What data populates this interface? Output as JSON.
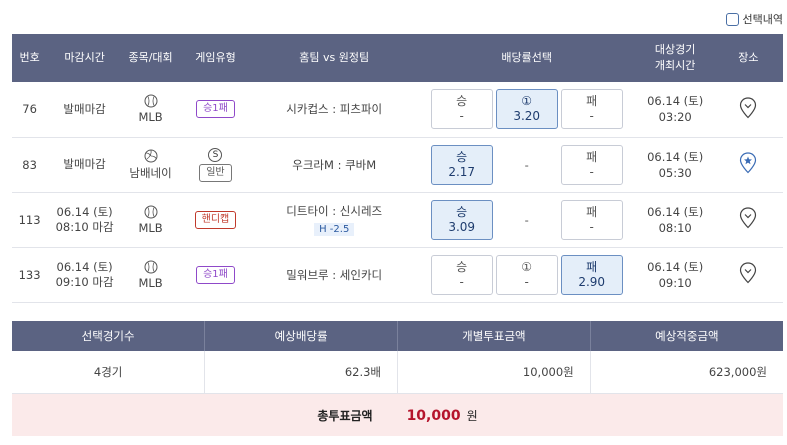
{
  "top": {
    "selection_history_label": "선택내역"
  },
  "headers": {
    "num": "번호",
    "deadline": "마감시간",
    "sport": "종목/대회",
    "type": "게임유형",
    "teams": "홈팀 vs 원정팀",
    "odds": "배당률선택",
    "gtime_line1": "대상경기",
    "gtime_line2": "개최시간",
    "venue": "장소"
  },
  "rows": [
    {
      "num": "76",
      "deadline_line1": "발매마감",
      "deadline_line2": "",
      "sport": "MLB",
      "sport_icon": "baseball-icon",
      "type": "승1패",
      "type_color": "purple",
      "type_extra": "",
      "teams": "시카컵스 : 피츠파이",
      "handicap": "",
      "odd_win_label": "승",
      "odd_win_val": "-",
      "odd_draw_label": "①",
      "odd_draw_val": "3.20",
      "odd_lose_label": "패",
      "odd_lose_val": "-",
      "gdate": "06.14 (토)",
      "gtime": "03:20",
      "venue_icon": "map-pin-icon"
    },
    {
      "num": "83",
      "deadline_line1": "발매마감",
      "deadline_line2": "",
      "sport": "남배네이",
      "sport_icon": "volleyball-icon",
      "type": "일반",
      "type_color": "gray",
      "type_extra": "S",
      "teams": "우크라M : 쿠바M",
      "handicap": "",
      "odd_win_label": "승",
      "odd_win_val": "2.17",
      "odd_draw_label": "",
      "odd_draw_val": "-",
      "odd_lose_label": "패",
      "odd_lose_val": "-",
      "gdate": "06.14 (토)",
      "gtime": "05:30",
      "venue_icon": "map-pin-star-icon"
    },
    {
      "num": "113",
      "deadline_line1": "06.14 (토)",
      "deadline_line2": "08:10 마감",
      "sport": "MLB",
      "sport_icon": "baseball-icon",
      "type": "핸디캡",
      "type_color": "red",
      "type_extra": "",
      "teams": "디트타이 : 신시레즈",
      "handicap": "H -2.5",
      "odd_win_label": "승",
      "odd_win_val": "3.09",
      "odd_draw_label": "",
      "odd_draw_val": "-",
      "odd_lose_label": "패",
      "odd_lose_val": "-",
      "gdate": "06.14 (토)",
      "gtime": "08:10",
      "venue_icon": "map-pin-icon"
    },
    {
      "num": "133",
      "deadline_line1": "06.14 (토)",
      "deadline_line2": "09:10 마감",
      "sport": "MLB",
      "sport_icon": "baseball-icon",
      "type": "승1패",
      "type_color": "purple",
      "type_extra": "",
      "teams": "밀워브루 : 세인카디",
      "handicap": "",
      "odd_win_label": "승",
      "odd_win_val": "-",
      "odd_draw_label": "①",
      "odd_draw_val": "-",
      "odd_lose_label": "패",
      "odd_lose_val": "2.90",
      "gdate": "06.14 (토)",
      "gtime": "09:10",
      "venue_icon": "map-pin-icon"
    }
  ],
  "summary": {
    "headers": [
      "선택경기수",
      "예상배당률",
      "개별투표금액",
      "예상적중금액"
    ],
    "games": "4경기",
    "odds": "62.3배",
    "bet": "10,000원",
    "payout": "623,000원"
  },
  "total": {
    "label": "총투표금액",
    "amount": "10,000",
    "unit": "원"
  },
  "colors": {
    "header_bg": "#5b6382",
    "selected_odd_bg": "#e4eef9",
    "total_bg": "#fbeaea",
    "total_amount": "#b5142c"
  }
}
